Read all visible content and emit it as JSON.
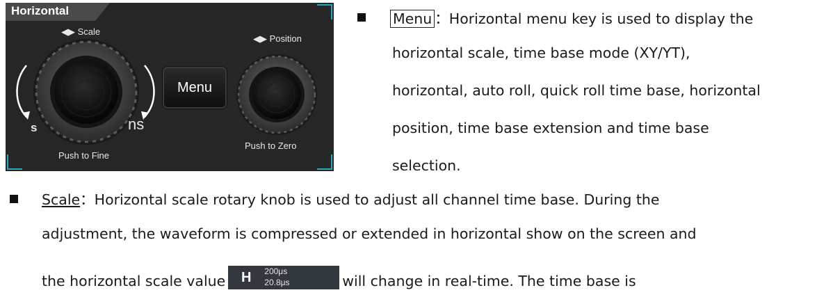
{
  "panel": {
    "title": "Horizontal",
    "scale_label": "◀▶ Scale",
    "position_label": "◀▶ Position",
    "menu_key": "Menu",
    "s_label": "s",
    "ns_label": "ns",
    "push_to_fine": "Push to Fine",
    "push_to_zero": "Push to Zero",
    "accent_color": "#2aa6c2"
  },
  "menu_item": {
    "key": "Menu",
    "line1": "：Horizontal menu key is used to display the",
    "line2": "horizontal scale, time base mode (XY/YT),",
    "line3": "horizontal, auto roll, quick roll time base, horizontal",
    "line4": "position, time base extension and time base",
    "line5": "selection."
  },
  "scale_item": {
    "key": "Scale",
    "line1": "：Horizontal scale rotary knob is used to adjust all channel time base. During the",
    "line2": "adjustment, the waveform is compressed or extended in horizontal show on the screen and",
    "line3_before": "the horizontal scale value",
    "line3_after": "will change in real-time. The time base is"
  },
  "readout": {
    "letter": "H",
    "value_top": "200μs",
    "value_bottom": "20.8μs"
  }
}
